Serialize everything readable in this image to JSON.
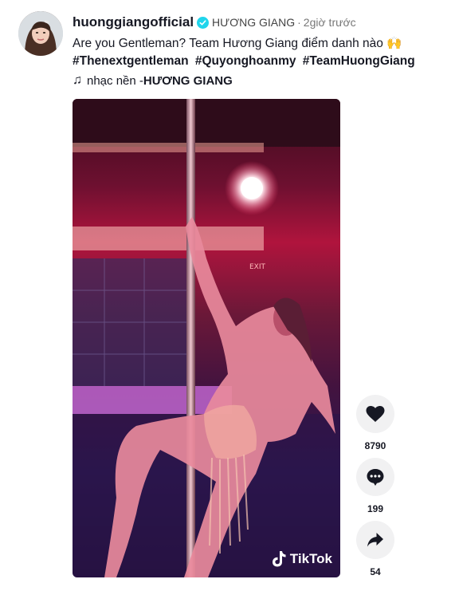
{
  "post": {
    "username": "huonggiangofficial",
    "nickname": "HƯƠNG GIANG",
    "separator": "·",
    "time_ago": "2giờ trước",
    "caption_text": "Are you Gentleman? Team Hương Giang điểm danh nào",
    "caption_emoji": "🙌",
    "hashtags": [
      "#Thenextgentleman",
      "#Quyonghoanmy",
      "#TeamHuongGiang"
    ],
    "music_prefix": "nhạc nền - ",
    "music_title": "HƯƠNG GIANG",
    "watermark": "TikTok"
  },
  "actions": {
    "likes": "8790",
    "comments": "199",
    "shares": "54"
  },
  "colors": {
    "verified": "#20d5ec",
    "action_bg": "#f1f1f2",
    "text": "#161823"
  },
  "icons": [
    "verified-icon",
    "music-note-icon",
    "heart-icon",
    "comment-icon",
    "share-icon",
    "tiktok-logo-icon"
  ]
}
